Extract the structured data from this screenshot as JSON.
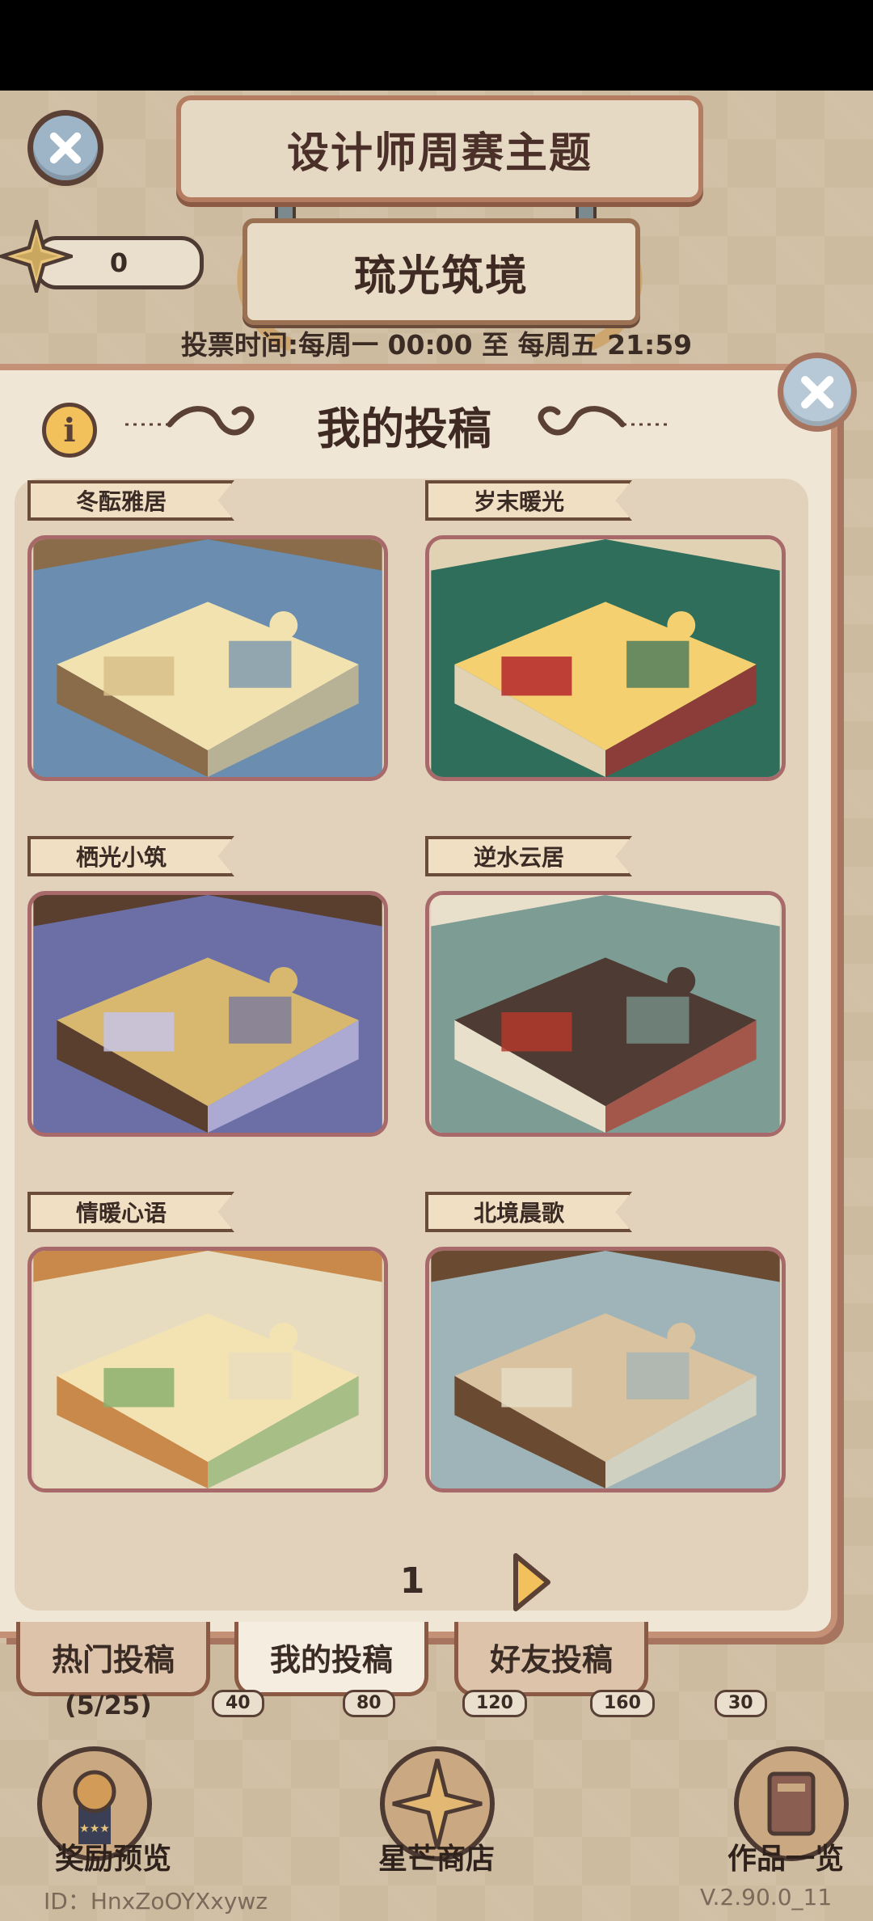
{
  "header": {
    "title": "设计师周赛主题",
    "theme": "琉光筑境",
    "vote_time": "投票时间:每周一 00:00 至 每周五 21:59",
    "star_count": "0"
  },
  "panel": {
    "title": "我的投稿",
    "info_symbol": "i",
    "entries": [
      {
        "label": "冬酝雅居",
        "palette": [
          "#6a8db0",
          "#d9c08a",
          "#8a6b4a",
          "#f2e2b0"
        ]
      },
      {
        "label": "岁末暖光",
        "palette": [
          "#2f6e5a",
          "#b3262b",
          "#e2d2b4",
          "#f5d070"
        ]
      },
      {
        "label": "栖光小筑",
        "palette": [
          "#6b6fa6",
          "#c7c3e6",
          "#5a3e2e",
          "#d7b86e"
        ]
      },
      {
        "label": "逆水云居",
        "palette": [
          "#7c9c94",
          "#b33a2c",
          "#e9e0cc",
          "#4e3b33"
        ]
      },
      {
        "label": "情暖心语",
        "palette": [
          "#e7dcc0",
          "#8bb06e",
          "#c8894a",
          "#f3e3b2"
        ]
      },
      {
        "label": "北境晨歌",
        "palette": [
          "#9fb4b8",
          "#e6ddc4",
          "#6b4a32",
          "#d8c2a0"
        ]
      }
    ],
    "page": "1"
  },
  "tabs": [
    {
      "label": "热门投稿"
    },
    {
      "label": "我的投稿"
    },
    {
      "label": "好友投稿"
    }
  ],
  "progress": {
    "count": "(5/25)",
    "milestones": [
      "40",
      "80",
      "120",
      "160",
      "30"
    ]
  },
  "bottom_nav": [
    {
      "label": "奖励预览",
      "icon": "trophy-icon"
    },
    {
      "label": "星芒商店",
      "icon": "star-shop-icon"
    },
    {
      "label": "作品一览",
      "icon": "book-icon"
    }
  ],
  "footer": {
    "user_id": "ID：HnxZoOYXxywz",
    "version": "V.2.90.0_11"
  }
}
